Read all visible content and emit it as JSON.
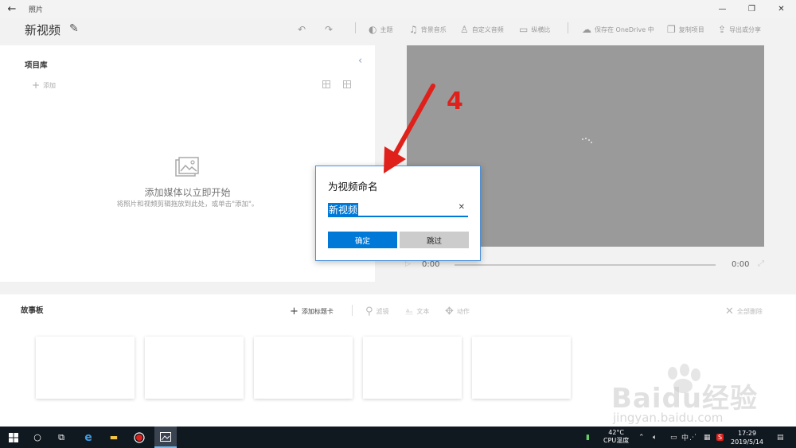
{
  "titlebar": {
    "back": "←",
    "app_name": "照片",
    "minimize": "—",
    "restore": "❐",
    "close": "✕"
  },
  "toolbar": {
    "project_title": "新视频",
    "undo": "↶",
    "redo": "↷",
    "theme": "主题",
    "music": "背景音乐",
    "custom_audio": "自定义音频",
    "aspect": "纵横比",
    "save_onedrive": "保存在 OneDrive 中",
    "copy_project": "复制项目",
    "export_share": "导出或分享"
  },
  "library": {
    "title": "项目库",
    "add": "添加",
    "empty_main": "添加媒体以立即开始",
    "empty_sub": "将照片和视频剪辑拖放到此处，或单击\"添加\"。"
  },
  "playback": {
    "current": "0:00",
    "total": "0:00"
  },
  "storyboard": {
    "title": "故事板",
    "add_title_card": "添加标题卡",
    "filter": "滤镜",
    "text": "文本",
    "motion": "动作",
    "remove_all": "全部删除"
  },
  "dialog": {
    "title": "为视频命名",
    "input_value": "新视频",
    "ok": "确定",
    "skip": "跳过"
  },
  "annotation": {
    "step": "4",
    "color": "#e0201a"
  },
  "watermark": {
    "brand": "Baidu经验",
    "url": "jingyan.baidu.com"
  },
  "taskbar": {
    "temp": "42°C",
    "temp_label": "CPU温度",
    "ime": "中",
    "time": "17:29",
    "date": "2019/5/14"
  },
  "colors": {
    "accent": "#0078d7",
    "preview_bg": "#9a9a9a",
    "taskbar_bg": "#101820"
  }
}
